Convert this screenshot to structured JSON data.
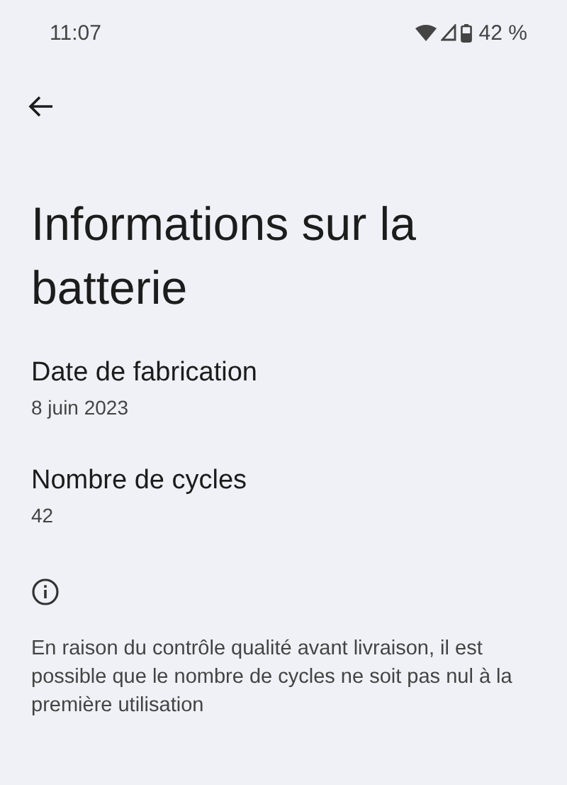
{
  "status_bar": {
    "time": "11:07",
    "battery": "42 %"
  },
  "title": "Informations sur la batterie",
  "items": [
    {
      "label": "Date de fabrication",
      "value": "8 juin 2023"
    },
    {
      "label": "Nombre de cycles",
      "value": "42"
    }
  ],
  "note": "En raison du contrôle qualité avant livraison, il est possible que le nombre de cycles ne soit pas nul à la première utilisation"
}
